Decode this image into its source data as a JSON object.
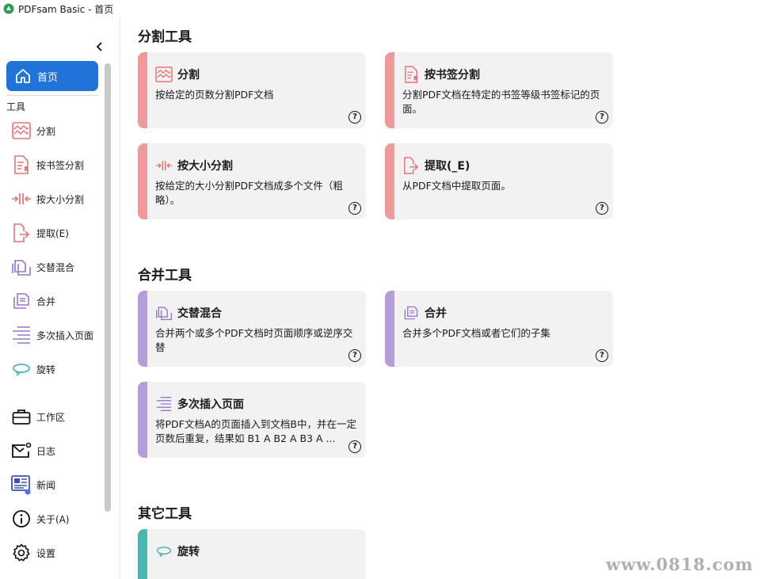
{
  "window": {
    "title": "PDFsam Basic - 首页"
  },
  "sidebar": {
    "home_label": "首页",
    "section_tools": "工具",
    "tools": [
      {
        "label": "分割",
        "icon": "split-icon"
      },
      {
        "label": "按书签分割",
        "icon": "bookmark-split-icon"
      },
      {
        "label": "按大小分割",
        "icon": "size-split-icon"
      },
      {
        "label": "提取(E)",
        "icon": "extract-icon"
      },
      {
        "label": "交替混合",
        "icon": "alternate-mix-icon"
      },
      {
        "label": "合并",
        "icon": "merge-icon"
      },
      {
        "label": "多次插入页面",
        "icon": "insert-pages-icon"
      },
      {
        "label": "旋转",
        "icon": "rotate-icon"
      }
    ],
    "bottom": [
      {
        "label": "工作区",
        "icon": "briefcase-icon"
      },
      {
        "label": "日志",
        "icon": "mail-icon"
      },
      {
        "label": "新闻",
        "icon": "news-icon"
      },
      {
        "label": "关于(A)",
        "icon": "info-icon"
      },
      {
        "label": "设置",
        "icon": "gear-icon"
      }
    ]
  },
  "groups": {
    "split": {
      "title": "分割工具",
      "cards": [
        {
          "title": "分割",
          "desc": "按给定的页数分割PDF文档"
        },
        {
          "title": "按书签分割",
          "desc": "分割PDF文档在特定的书签等级书签标记的页面。"
        },
        {
          "title": "按大小分割",
          "desc": "按给定的大小分割PDF文档成多个文件（粗略）。"
        },
        {
          "title": "提取(_E)",
          "desc": "从PDF文档中提取页面。"
        }
      ]
    },
    "merge": {
      "title": "合并工具",
      "cards": [
        {
          "title": "交替混合",
          "desc": "合并两个或多个PDF文档时页面顺序或逆序交替"
        },
        {
          "title": "合并",
          "desc": "合并多个PDF文档或者它们的子集"
        },
        {
          "title": "多次插入页面",
          "desc": "将PDF文档A的页面插入到文档B中，并在一定页数后重复，结果如 B1 A B2 A B3 A ..."
        }
      ]
    },
    "other": {
      "title": "其它工具",
      "cards": [
        {
          "title": "旋转",
          "desc": ""
        }
      ]
    }
  },
  "help_glyph": "?",
  "watermark": "www.0818.com",
  "colors": {
    "accent": "#1f73d9",
    "split": "#ef9a9a",
    "merge": "#b39ddb",
    "other": "#4db6ac"
  }
}
